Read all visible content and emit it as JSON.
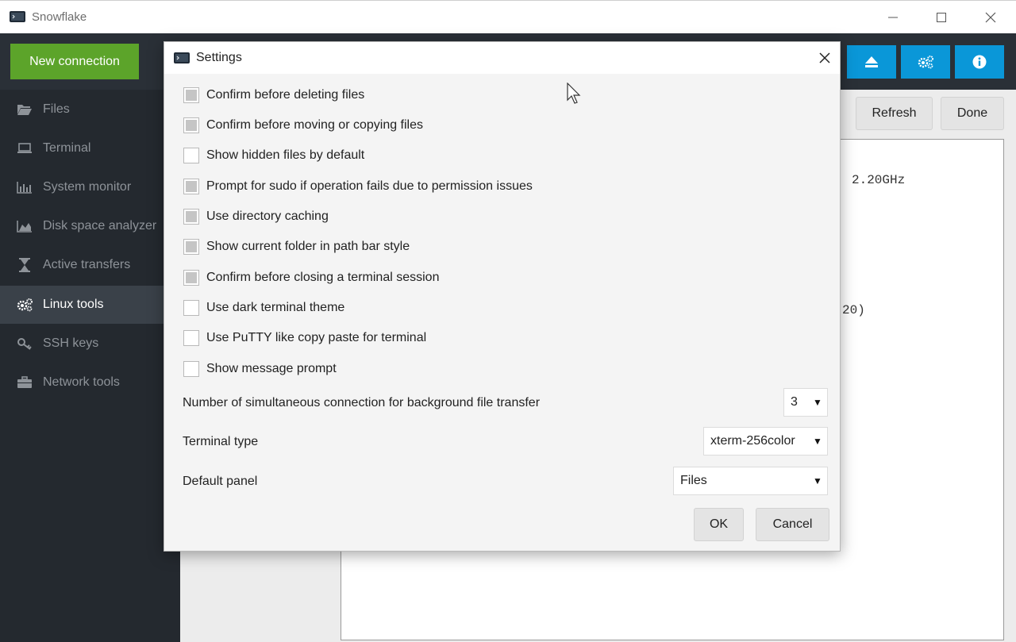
{
  "window": {
    "title": "Snowflake",
    "icon": "terminal-app-icon"
  },
  "sidebar": {
    "new_connection_label": "New connection",
    "accent": "#5ca42a",
    "items": [
      {
        "label": "Files",
        "icon": "folder-open-icon"
      },
      {
        "label": "Terminal",
        "icon": "laptop-icon"
      },
      {
        "label": "System monitor",
        "icon": "bar-chart-icon"
      },
      {
        "label": "Disk space analyzer",
        "icon": "area-chart-icon"
      },
      {
        "label": "Active transfers",
        "icon": "hourglass-icon"
      },
      {
        "label": "Linux tools",
        "icon": "cogs-icon",
        "active": true
      },
      {
        "label": "SSH keys",
        "icon": "key-icon"
      },
      {
        "label": "Network tools",
        "icon": "briefcase-icon"
      }
    ]
  },
  "header": {
    "buttons": [
      {
        "icon": "eject-icon"
      },
      {
        "icon": "cogs-icon"
      },
      {
        "icon": "info-icon"
      }
    ],
    "button_color": "#0a97d8"
  },
  "main": {
    "refresh_label": "Refresh",
    "done_label": "Done",
    "terminal_lines": [
      "2.20GHz",
      "20)"
    ]
  },
  "dialog": {
    "title": "Settings",
    "options": [
      {
        "label": "Confirm before deleting files",
        "checked": true
      },
      {
        "label": "Confirm before moving or copying files",
        "checked": true
      },
      {
        "label": "Show hidden files by default",
        "checked": false
      },
      {
        "label": "Prompt for sudo if operation fails due to permission issues",
        "checked": true
      },
      {
        "label": "Use directory caching",
        "checked": true
      },
      {
        "label": "Show current folder in path bar style",
        "checked": true
      },
      {
        "label": "Confirm before closing a terminal session",
        "checked": true
      },
      {
        "label": "Use dark terminal theme",
        "checked": false
      },
      {
        "label": "Use PuTTY like copy paste for terminal",
        "checked": false
      },
      {
        "label": "Show message prompt",
        "checked": false
      }
    ],
    "connections_label": "Number of simultaneous connection for background file transfer",
    "connections_value": "3",
    "terminal_type_label": "Terminal type",
    "terminal_type_value": "xterm-256color",
    "default_panel_label": "Default panel",
    "default_panel_value": "Files",
    "ok_label": "OK",
    "cancel_label": "Cancel"
  }
}
